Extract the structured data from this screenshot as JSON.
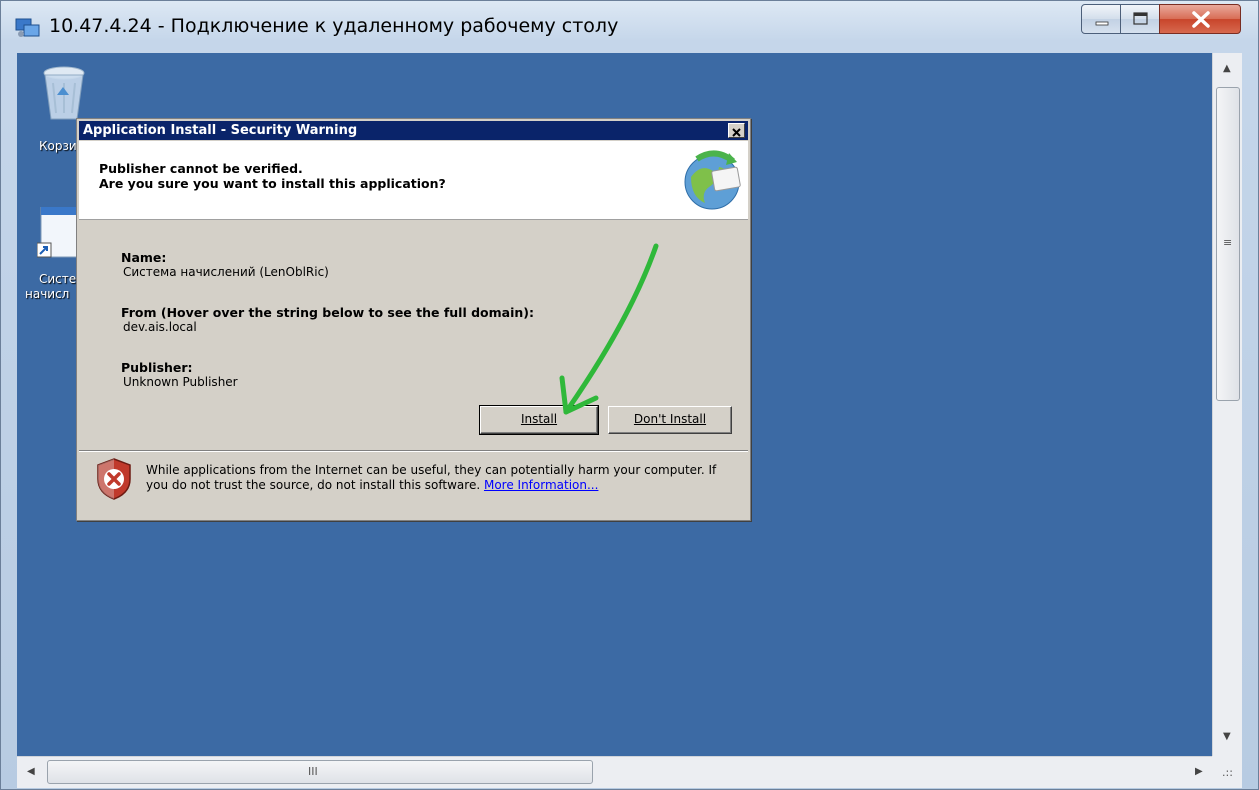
{
  "rdp_window": {
    "title": "10.47.4.24 - Подключение к удаленному рабочему столу",
    "controls": {
      "minimize": "minimize",
      "maximize": "maximize",
      "close": "close"
    }
  },
  "desktop": {
    "background": "#3c6aa4",
    "icons": [
      {
        "label": "Корзи",
        "icon": "recycle-bin-icon"
      },
      {
        "label_line1": "Систе",
        "label_line2": "начисл",
        "icon": "shortcut-icon"
      }
    ]
  },
  "dialog": {
    "title": "Application Install - Security Warning",
    "header_line1": "Publisher cannot be verified.",
    "header_line2": "Are you sure you want to install this application?",
    "name_label": "Name:",
    "name_value": "Система начислений (LenOblRic)",
    "from_label": "From (Hover over the string below to see the full domain):",
    "from_value": "dev.ais.local",
    "publisher_label": "Publisher:",
    "publisher_value": "Unknown Publisher",
    "install_button": "Install",
    "dont_install_button": "Don't Install",
    "footer_text": "While applications from the Internet can be useful, they can potentially harm your computer. If you do not trust the source, do not install this software.",
    "more_info_link": "More Information..."
  },
  "scrollbars": {
    "horizontal_grip": "III",
    "corner_grip": ".::"
  },
  "colors": {
    "title_bar": "#0a246a",
    "dialog_face": "#d4d0c8",
    "annotation_arrow": "#2fb83a",
    "link": "#0000ff"
  }
}
